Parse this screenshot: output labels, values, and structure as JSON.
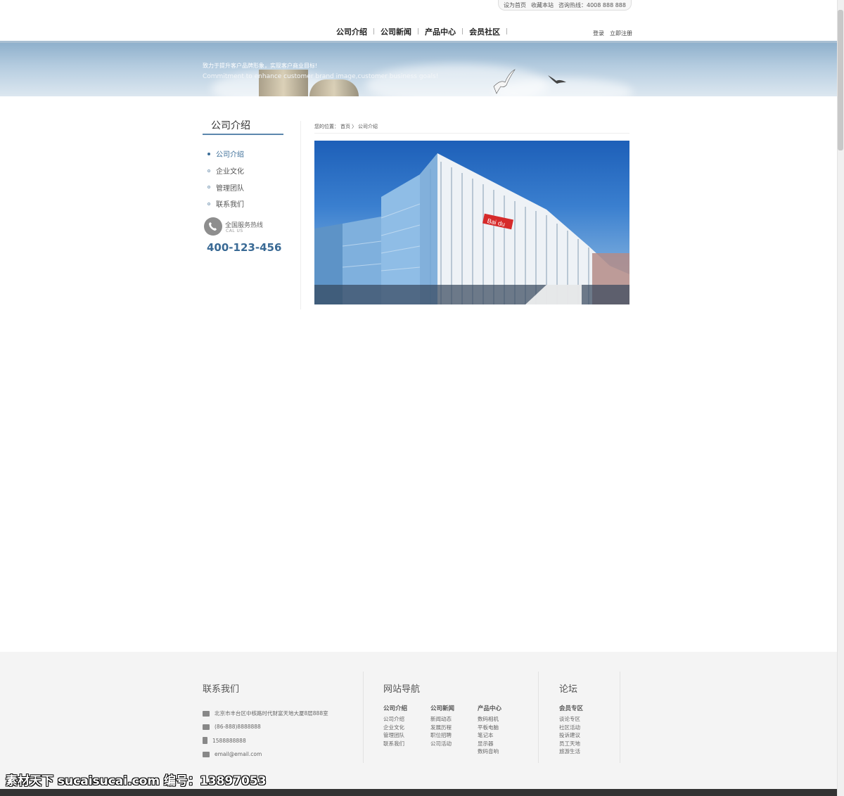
{
  "topbar": {
    "set_home": "设为首页",
    "bookmark": "收藏本站",
    "hotline": "咨询热线：4008 888 888"
  },
  "nav": {
    "items": [
      "公司介绍",
      "公司新闻",
      "产品中心",
      "会员社区"
    ],
    "login": "登录",
    "register": "立即注册"
  },
  "banner": {
    "slogan_cn": "致力于提升客户品牌形象，实现客户商业目标!",
    "slogan_en": "Commitment to enhance customer brand image,customer business goals!"
  },
  "sidebar": {
    "title": "公司介绍",
    "items": [
      {
        "label": "公司介绍",
        "active": true
      },
      {
        "label": "企业文化",
        "active": false
      },
      {
        "label": "管理团队",
        "active": false
      },
      {
        "label": "联系我们",
        "active": false
      }
    ],
    "hotline_label": "全国服务热线",
    "hotline_sub": "CAL US",
    "hotline_number": "400-123-456"
  },
  "breadcrumb": {
    "prefix": "您的位置：",
    "home": "首页",
    "sep": "〉",
    "current": "公司介绍"
  },
  "photo": {
    "sign_text": "Bai du"
  },
  "footer": {
    "contact_title": "联系我们",
    "address": "北京市丰台区中核路时代财富天地大厦8层888室",
    "phone": "(86-888)8888888",
    "mobile": "1588888888",
    "email": "email@email.com",
    "nav_title": "网站导航",
    "forum_title": "论坛",
    "columns": [
      {
        "title": "公司介绍",
        "links": [
          "公司介绍",
          "企业文化",
          "管理团队",
          "联系我们"
        ]
      },
      {
        "title": "公司新闻",
        "links": [
          "新闻动态",
          "发展历程",
          "职位招聘",
          "公司活动"
        ]
      },
      {
        "title": "产品中心",
        "links": [
          "数码相机",
          "平板电脑",
          "笔记本",
          "显示器",
          "数码音响"
        ]
      }
    ],
    "forum_column": {
      "title": "会员专区",
      "links": [
        "谈论专区",
        "社区活动",
        "投诉建议",
        "员工天地",
        "旅游生活"
      ]
    }
  },
  "watermark": "素材天下 sucaisucai.com  编号：13897053",
  "colors": {
    "accent": "#3b6d97",
    "banner_top": "#8fb0cc",
    "footer_bg": "#f4f4f4"
  }
}
